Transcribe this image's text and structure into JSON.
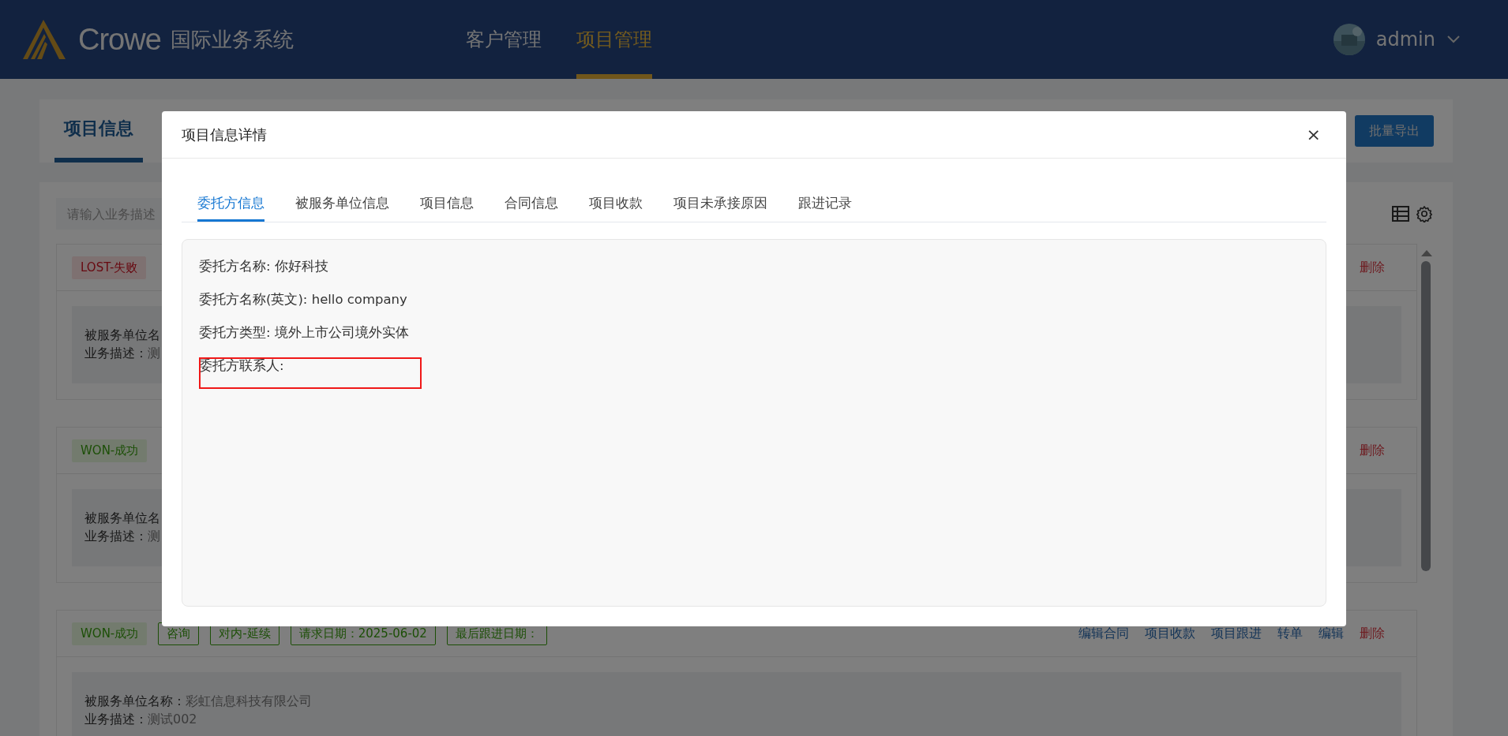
{
  "header": {
    "logo_text": "Crowe",
    "system_name": "国际业务系统",
    "nav": [
      {
        "label": "客户管理",
        "selected": false
      },
      {
        "label": "项目管理",
        "selected": true
      }
    ],
    "user": "admin"
  },
  "page_tabs": [
    {
      "label": "项目信息",
      "selected": true
    }
  ],
  "export_button": "批量导出",
  "search": {
    "placeholder": "请输入业务描述"
  },
  "projects": [
    {
      "tags": [
        {
          "label": "LOST-失败",
          "kind": "lost"
        }
      ],
      "actions": [
        {
          "label": "删除",
          "kind": "danger"
        }
      ],
      "fields": [
        {
          "label": "被服务单位名"
        },
        {
          "label": "业务描述：",
          "value": "测"
        }
      ]
    },
    {
      "tags": [
        {
          "label": "WON-成功",
          "kind": "won"
        }
      ],
      "actions": [
        {
          "label": "删除",
          "kind": "danger"
        }
      ],
      "fields": [
        {
          "label": "被服务单位名"
        },
        {
          "label": "业务描述：",
          "value": "测"
        }
      ]
    },
    {
      "tags": [
        {
          "label": "WON-成功",
          "kind": "won"
        },
        {
          "label": "咨询",
          "kind": "outline"
        },
        {
          "label": "对内-延续",
          "kind": "outline"
        },
        {
          "label": "请求日期：2025-06-02",
          "kind": "outline"
        },
        {
          "label": "最后跟进日期：",
          "kind": "outline"
        }
      ],
      "actions": [
        {
          "label": "编辑合同",
          "kind": "link"
        },
        {
          "label": "项目收款",
          "kind": "link"
        },
        {
          "label": "项目跟进",
          "kind": "link"
        },
        {
          "label": "转单",
          "kind": "link"
        },
        {
          "label": "编辑",
          "kind": "link"
        },
        {
          "label": "删除",
          "kind": "danger"
        }
      ],
      "fields": [
        {
          "label": "被服务单位名称：",
          "value": "彩虹信息科技有限公司"
        },
        {
          "label": "业务描述：",
          "value": "测试002"
        }
      ]
    }
  ],
  "modal": {
    "title": "项目信息详情",
    "close": "×",
    "tabs": [
      {
        "label": "委托方信息",
        "selected": true
      },
      {
        "label": "被服务单位信息",
        "selected": false
      },
      {
        "label": "项目信息",
        "selected": false
      },
      {
        "label": "合同信息",
        "selected": false
      },
      {
        "label": "项目收款",
        "selected": false
      },
      {
        "label": "项目未承接原因",
        "selected": false
      },
      {
        "label": "跟进记录",
        "selected": false
      }
    ],
    "fields": [
      {
        "text": "委托方名称: 你好科技",
        "highlighted": false
      },
      {
        "text": "委托方名称(英文): hello company",
        "highlighted": false
      },
      {
        "text": "委托方类型: 境外上市公司境外实体",
        "highlighted": false
      },
      {
        "text": "委托方联系人:",
        "highlighted": true
      }
    ]
  }
}
